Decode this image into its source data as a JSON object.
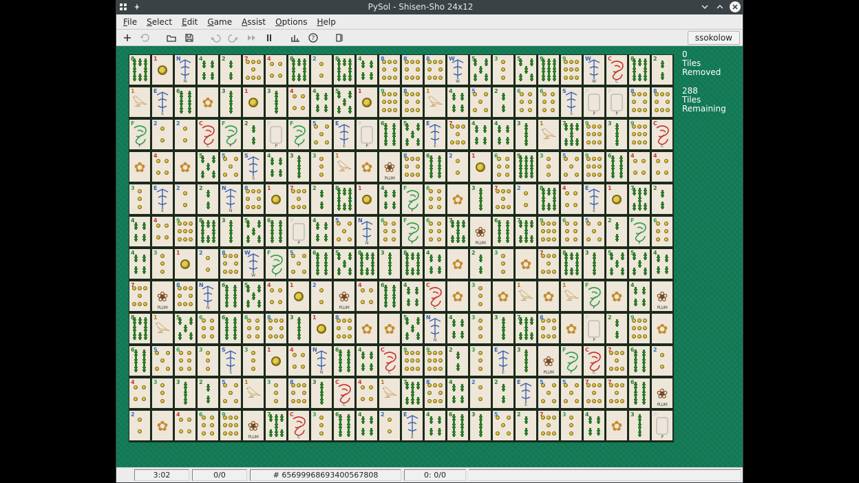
{
  "window": {
    "title": "PySol - Shisen-Sho 24x12"
  },
  "menubar": {
    "items": [
      {
        "label": "File",
        "mnemonic": "F"
      },
      {
        "label": "Select",
        "mnemonic": "S"
      },
      {
        "label": "Edit",
        "mnemonic": "E"
      },
      {
        "label": "Game",
        "mnemonic": "G"
      },
      {
        "label": "Assist",
        "mnemonic": "A"
      },
      {
        "label": "Options",
        "mnemonic": "O"
      },
      {
        "label": "Help",
        "mnemonic": "H"
      }
    ]
  },
  "toolbar": {
    "buttons": [
      {
        "name": "new-game-icon",
        "glyph": "plus",
        "enabled": true
      },
      {
        "name": "restart-icon",
        "glyph": "refresh",
        "enabled": false
      },
      {
        "gap": true
      },
      {
        "name": "open-icon",
        "glyph": "open",
        "enabled": true
      },
      {
        "name": "save-icon",
        "glyph": "save",
        "enabled": true
      },
      {
        "gap": true
      },
      {
        "name": "undo-icon",
        "glyph": "undo",
        "enabled": false
      },
      {
        "name": "redo-icon",
        "glyph": "redo",
        "enabled": false
      },
      {
        "name": "autodrop-icon",
        "glyph": "ffwd",
        "enabled": false
      },
      {
        "name": "pause-icon",
        "glyph": "pause",
        "enabled": true
      },
      {
        "gap": true
      },
      {
        "name": "statistics-icon",
        "glyph": "stats",
        "enabled": true
      },
      {
        "name": "rules-icon",
        "glyph": "help",
        "enabled": true
      },
      {
        "gap": true
      },
      {
        "name": "quit-icon",
        "glyph": "quit",
        "enabled": true
      }
    ],
    "player_label": "ssokolow"
  },
  "stats": {
    "removed_count": "0",
    "removed_label": "Tiles\nRemoved",
    "remaining_count": "288",
    "remaining_label": "Tiles\nRemaining"
  },
  "statusbar": {
    "time": "3:02",
    "moves": "0/0",
    "game": "# 65699968693400567808",
    "score": "0: 0/0"
  },
  "board": {
    "rows": 12,
    "cols": 24,
    "tiles": [
      [
        "B8",
        "C1",
        "WN",
        "B4",
        "B2",
        "C7",
        "C4",
        "B8",
        "C2",
        "B8",
        "B4",
        "C8",
        "C8",
        "C8",
        "WW",
        "B5",
        "C3",
        "B5",
        "B9",
        "C9",
        "WW",
        "DR",
        "B8",
        "B2"
      ],
      [
        "B1",
        "WE",
        "B6",
        "FS",
        "B3",
        "C1",
        "B3",
        "C4",
        "B4",
        "B5",
        "C1",
        "C9",
        "C8",
        "B1",
        "B4",
        "C5",
        "B2",
        "C6",
        "C6",
        "WS",
        "DW",
        "DW",
        "C8",
        "C8"
      ],
      [
        "DG",
        "C2",
        "C2",
        "DR",
        "DG",
        "B2",
        "DW",
        "DG",
        "C5",
        "WE",
        "DW",
        "B6",
        "B5",
        "WE",
        "C7",
        "B4",
        "B4",
        "B3",
        "B1",
        "B7",
        "C9",
        "B3",
        "C9",
        "DR"
      ],
      [
        "FS",
        "C4",
        "FS",
        "B5",
        "C5",
        "WS",
        "B4",
        "B3",
        "C3",
        "B1",
        "FS",
        "F1",
        "C8",
        "B6",
        "C2",
        "C1",
        "C6",
        "B9",
        "C3",
        "C5",
        "C9",
        "B6",
        "C4",
        "C4"
      ],
      [
        "C3",
        "WE",
        "C2",
        "B2",
        "WN",
        "C8",
        "C1",
        "C7",
        "B2",
        "B8",
        "C1",
        "B4",
        "DG",
        "C6",
        "FS",
        "B3",
        "C7",
        "C2",
        "B8",
        "C4",
        "WE",
        "C1",
        "B7",
        "B2"
      ],
      [
        "B4",
        "C4",
        "C9",
        "B8",
        "B3",
        "B5",
        "B6",
        "DW",
        "B4",
        "C5",
        "WN",
        "C6",
        "DG",
        "C6",
        "B7",
        "F1",
        "B6",
        "B7",
        "C9",
        "C6",
        "C5",
        "B2",
        "DG",
        "C6"
      ],
      [
        "B4",
        "C3",
        "C1",
        "C2",
        "C8",
        "WW",
        "DG",
        "C5",
        "B6",
        "B5",
        "B8",
        "B3",
        "B8",
        "B4",
        "FS",
        "B2",
        "C3",
        "FS",
        "C7",
        "B8",
        "B3",
        "B5",
        "B5",
        "B4"
      ],
      [
        "C7",
        "F1",
        "C8",
        "WN",
        "B6",
        "B5",
        "C4",
        "C1",
        "C2",
        "F1",
        "C4",
        "B6",
        "B4",
        "DR",
        "FS",
        "C3",
        "FS",
        "B1",
        "FS",
        "B1",
        "DG",
        "FS",
        "B4",
        "F1"
      ],
      [
        "B8",
        "B1",
        "B5",
        "C6",
        "B6",
        "C6",
        "C8",
        "B3",
        "C1",
        "C8",
        "FS",
        "FS",
        "B5",
        "WN",
        "B4",
        "C3",
        "B3",
        "B7",
        "C8",
        "FS",
        "DW",
        "B2",
        "C9",
        "FS"
      ],
      [
        "B6",
        "C5",
        "C6",
        "C3",
        "WS",
        "C3",
        "C1",
        "C4",
        "WN",
        "B6",
        "B4",
        "DR",
        "C9",
        "C9",
        "B2",
        "C3",
        "WE",
        "B3",
        "F1",
        "DG",
        "DR",
        "C7",
        "B6",
        "C2"
      ],
      [
        "C4",
        "C3",
        "B3",
        "B2",
        "C5",
        "B1",
        "C3",
        "C8",
        "B3",
        "DR",
        "C4",
        "B1",
        "B7",
        "C8",
        "B4",
        "C2",
        "B2",
        "WE",
        "C5",
        "C5",
        "C7",
        "C7",
        "B6",
        "F1"
      ],
      [
        "C2",
        "FS",
        "C4",
        "C6",
        "C9",
        "F1",
        "B7",
        "DR",
        "C3",
        "B6",
        "B4",
        "C2",
        "WE",
        "B4",
        "B6",
        "B3",
        "C5",
        "B2",
        "C7",
        "C3",
        "B4",
        "FS",
        "B3",
        "DW"
      ]
    ]
  },
  "tile_def": {
    "C1": {
      "suit": "circles",
      "rank": 1,
      "corner": "1",
      "color": "#c5372f"
    },
    "C2": {
      "suit": "circles",
      "rank": 2,
      "corner": "2",
      "color": "#2f6fc5"
    },
    "C3": {
      "suit": "circles",
      "rank": 3,
      "corner": "3",
      "color": "#2f9f4d"
    },
    "C4": {
      "suit": "circles",
      "rank": 4,
      "corner": "4",
      "color": "#c5372f"
    },
    "C5": {
      "suit": "circles",
      "rank": 5,
      "corner": "5",
      "color": "#2f6fc5"
    },
    "C6": {
      "suit": "circles",
      "rank": 6,
      "corner": "6",
      "color": "#2f9f4d"
    },
    "C7": {
      "suit": "circles",
      "rank": 7,
      "corner": "7",
      "color": "#c5372f"
    },
    "C8": {
      "suit": "circles",
      "rank": 8,
      "corner": "8",
      "color": "#2f6fc5"
    },
    "C9": {
      "suit": "circles",
      "rank": 9,
      "corner": "9",
      "color": "#2f9f4d"
    },
    "B1": {
      "suit": "bamboo",
      "rank": 1,
      "corner": "1",
      "color": "#b57a22",
      "bird": true
    },
    "B2": {
      "suit": "bamboo",
      "rank": 2,
      "corner": "2",
      "color": "#2d7a2a"
    },
    "B3": {
      "suit": "bamboo",
      "rank": 3,
      "corner": "3",
      "color": "#2d7a2a"
    },
    "B4": {
      "suit": "bamboo",
      "rank": 4,
      "corner": "4",
      "color": "#2d7a2a"
    },
    "B5": {
      "suit": "bamboo",
      "rank": 5,
      "corner": "5",
      "color": "#2d7a2a"
    },
    "B6": {
      "suit": "bamboo",
      "rank": 6,
      "corner": "6",
      "color": "#2d7a2a"
    },
    "B7": {
      "suit": "bamboo",
      "rank": 7,
      "corner": "7",
      "color": "#2d7a2a"
    },
    "B8": {
      "suit": "bamboo",
      "rank": 8,
      "corner": "8",
      "color": "#2d7a2a"
    },
    "B9": {
      "suit": "bamboo",
      "rank": 9,
      "corner": "9",
      "color": "#2d7a2a"
    },
    "WN": {
      "suit": "wind",
      "label": "N",
      "corner": "N",
      "color": "#3a60b0",
      "glyph": "丠"
    },
    "WS": {
      "suit": "wind",
      "label": "S",
      "corner": "S",
      "color": "#3a60b0",
      "glyph": "〡"
    },
    "WE": {
      "suit": "wind",
      "label": "E",
      "corner": "E",
      "color": "#3a60b0",
      "glyph": "〣"
    },
    "WW": {
      "suit": "wind",
      "label": "W",
      "corner": "W",
      "color": "#3a60b0",
      "glyph": "〢"
    },
    "DG": {
      "suit": "dragon",
      "label": "F",
      "corner": "F",
      "color": "#2f9f4d",
      "glyph": "發"
    },
    "DR": {
      "suit": "dragon",
      "label": "C",
      "corner": "C",
      "color": "#c5372f",
      "glyph": "中"
    },
    "DW": {
      "suit": "dragon",
      "label": "P",
      "corner": "P",
      "color": "#d6d6d6",
      "glyph": "○"
    },
    "F1": {
      "suit": "flower",
      "corner": "",
      "color": "#7a4a1f",
      "label": "PLUM",
      "glyph": "❀"
    },
    "FS": {
      "suit": "flower",
      "corner": "",
      "color": "#c58a2f",
      "label": "",
      "glyph": "✿"
    }
  }
}
